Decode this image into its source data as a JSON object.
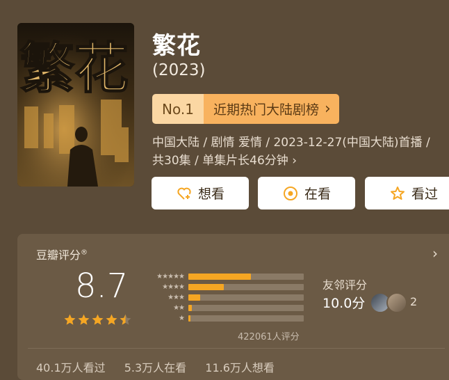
{
  "movie": {
    "title": "繁花",
    "year": "(2023)",
    "poster_calligraphy": "繁花"
  },
  "rank": {
    "number": "No.1",
    "label": "近期热门大陆剧榜",
    "chevron": "›"
  },
  "meta": {
    "line1": "中国大陆 / 剧情 爱情 / 2023-12-27(中国大陆)首播 /",
    "line2": "共30集 / 单集片长46分钟 ›"
  },
  "actions": {
    "want": {
      "label": "想看",
      "icon": "heart-plus-icon"
    },
    "watching": {
      "label": "在看",
      "icon": "target-icon"
    },
    "watched": {
      "label": "看过",
      "icon": "star-outline-icon"
    }
  },
  "rating": {
    "label": "豆瓣评分",
    "registered": "®",
    "score": "8.7",
    "stars": 4.5,
    "distribution": [
      {
        "stars": "★★★★★",
        "fraction": 0.54
      },
      {
        "stars": "★★★★",
        "fraction": 0.31
      },
      {
        "stars": "★★★",
        "fraction": 0.1
      },
      {
        "stars": "★★",
        "fraction": 0.03
      },
      {
        "stars": "★",
        "fraction": 0.02
      }
    ],
    "count_text": "422061人评分",
    "chevron": "›"
  },
  "friends": {
    "label": "友邻评分",
    "score": "10.0分",
    "count": "2"
  },
  "stats": {
    "watched": "40.1万人看过",
    "watching": "5.3万人在看",
    "want": "11.6万人想看"
  },
  "colors": {
    "accent": "#f5a623",
    "badge_light": "#fbd7a3",
    "badge_dark": "#f8b25e",
    "background": "#5b4b38"
  }
}
